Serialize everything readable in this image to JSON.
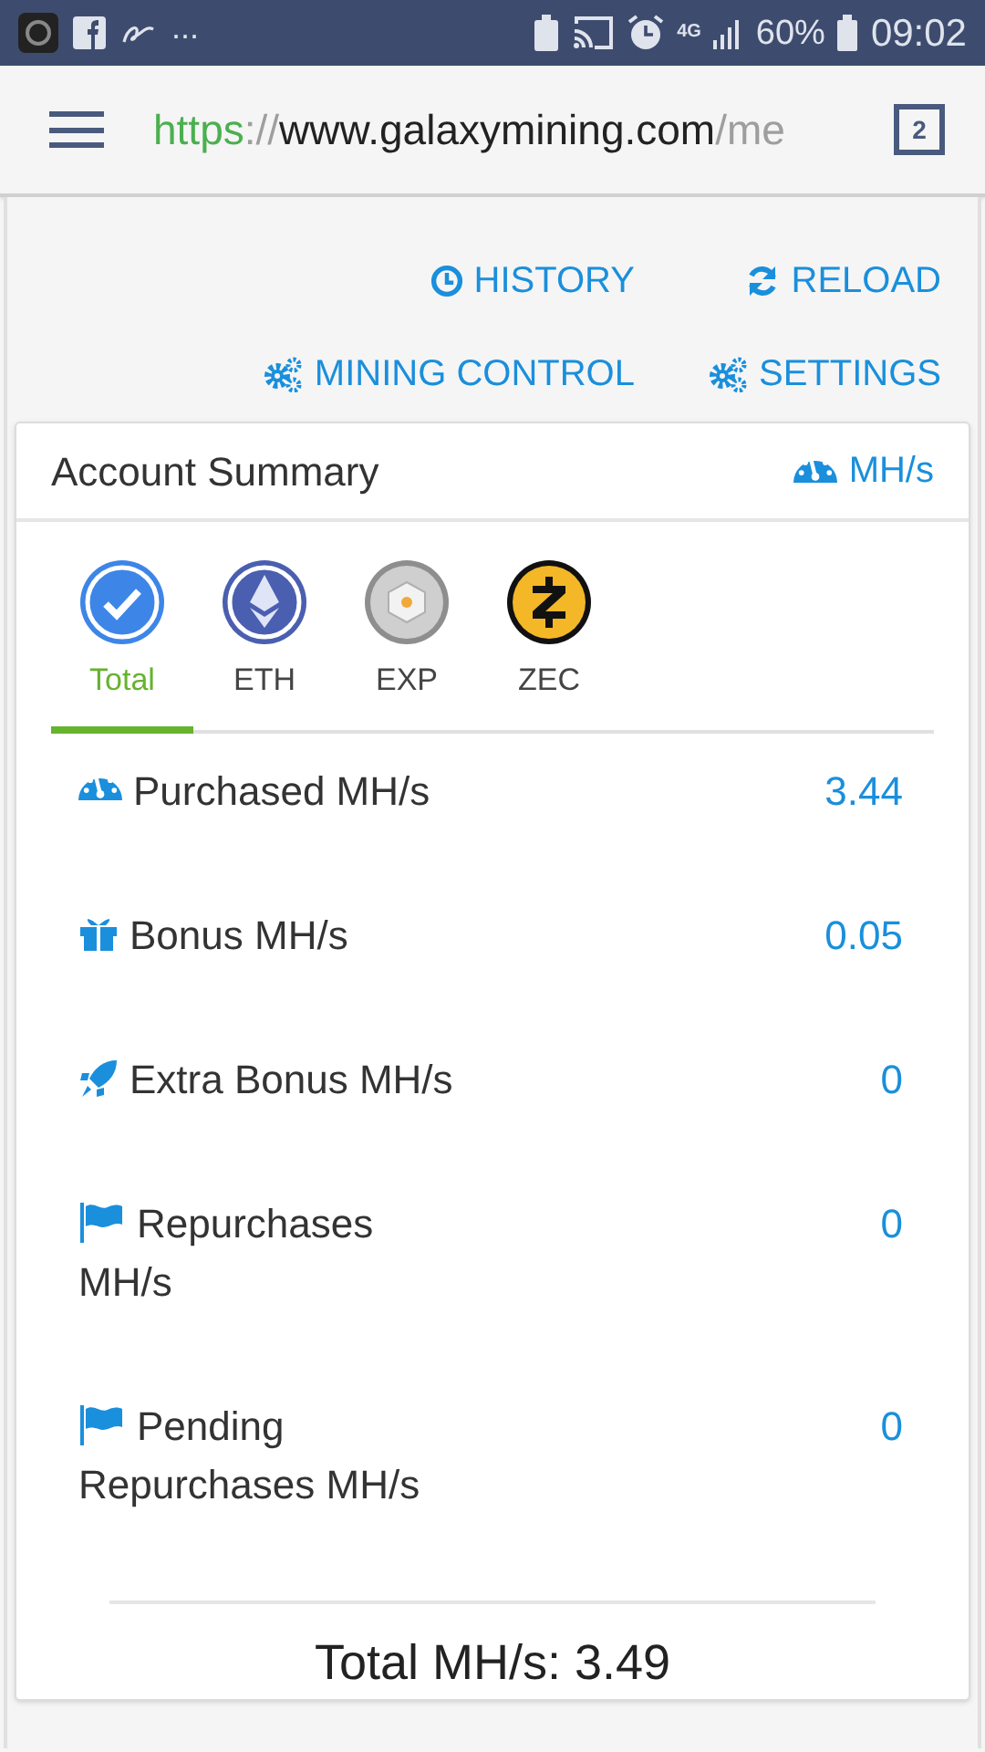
{
  "status_bar": {
    "more": "...",
    "network": "4G",
    "battery": "60%",
    "time": "09:02"
  },
  "address_bar": {
    "scheme": "https",
    "separator": "://",
    "host": "www.galaxymining.com",
    "path": "/me",
    "tab_count": "2"
  },
  "actions": [
    {
      "kind": "clock",
      "label": "HISTORY"
    },
    {
      "kind": "reload",
      "label": "RELOAD"
    },
    {
      "kind": "gears",
      "label": "MINING CONTROL"
    },
    {
      "kind": "gears",
      "label": "SETTINGS"
    }
  ],
  "card": {
    "title": "Account Summary",
    "unit": "MH/s",
    "tabs": [
      {
        "kind": "total",
        "label": "Total",
        "selected": true
      },
      {
        "kind": "eth",
        "label": "ETH",
        "selected": false
      },
      {
        "kind": "exp",
        "label": "EXP",
        "selected": false
      },
      {
        "kind": "zec",
        "label": "ZEC",
        "selected": false
      }
    ],
    "rows": [
      {
        "kind": "gauge",
        "label": "Purchased MH/s",
        "value": "3.44"
      },
      {
        "kind": "gift",
        "label": "Bonus MH/s",
        "value": "0.05"
      },
      {
        "kind": "rocket",
        "label": "Extra Bonus MH/s",
        "value": "0"
      },
      {
        "kind": "flag",
        "label": "Repurchases MH/s",
        "value": "0"
      },
      {
        "kind": "flag",
        "label": "Pending Repurchases MH/s",
        "value": "0"
      }
    ],
    "total": "Total MH/s: 3.49"
  }
}
